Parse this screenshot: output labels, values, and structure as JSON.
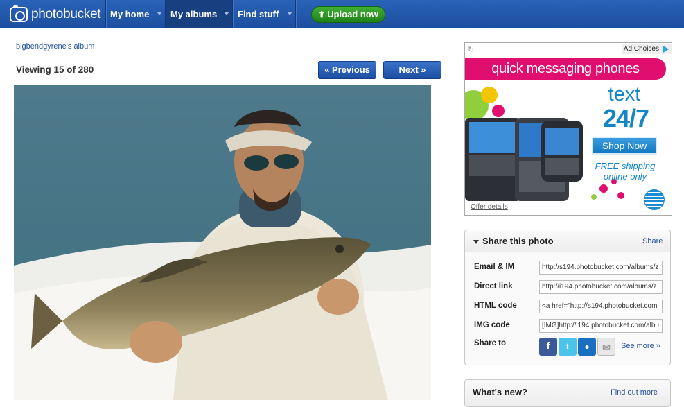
{
  "brand": {
    "name": "photobucket"
  },
  "nav": {
    "items": [
      {
        "label": "My home"
      },
      {
        "label": "My albums"
      },
      {
        "label": "Find stuff"
      }
    ],
    "upload_label": "Upload now"
  },
  "album": {
    "link": "bigbendgyrene's album",
    "viewing": "Viewing 15 of 280",
    "prev_label": "« Previous",
    "next_label": "Next »"
  },
  "ad": {
    "choices": "Ad Choices",
    "headline": "quick messaging phones",
    "text": "text",
    "big": "24/7",
    "cta": "Shop Now",
    "free1": "FREE shipping",
    "free2": "online only",
    "offer": "Offer details"
  },
  "share": {
    "title": "Share this photo",
    "share_link": "Share",
    "rows": [
      {
        "label": "Email & IM",
        "value": "http://s194.photobucket.com/albums/z"
      },
      {
        "label": "Direct link",
        "value": "http://i194.photobucket.com/albums/z"
      },
      {
        "label": "HTML code",
        "value": "<a href=\"http://s194.photobucket.com"
      },
      {
        "label": "IMG code",
        "value": "[IMG]http://i194.photobucket.com/albu"
      }
    ],
    "share_to": "Share to",
    "see_more": "See more »"
  },
  "whats_new": {
    "title": "What's new?",
    "link": "Find out more"
  },
  "colors": {
    "nav": "#1d4f9f",
    "upload": "#1f8217",
    "accent": "#e00f6f",
    "link": "#1f4f9a"
  }
}
